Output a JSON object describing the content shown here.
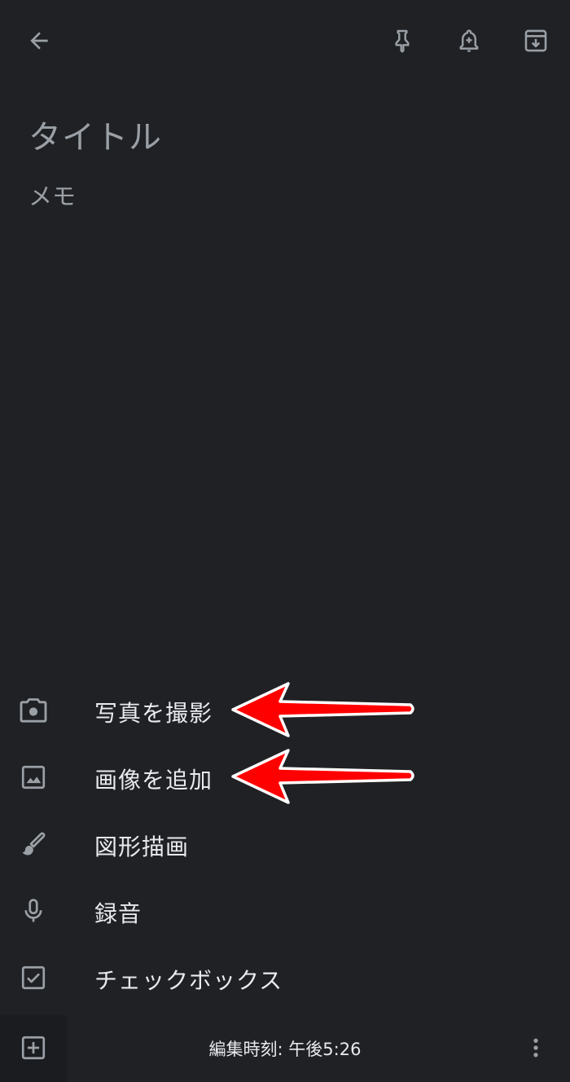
{
  "toolbar": {
    "back_icon": "arrow-left-icon",
    "pin_icon": "pin-icon",
    "reminder_icon": "bell-plus-icon",
    "archive_icon": "archive-icon"
  },
  "note": {
    "title_placeholder": "タイトル",
    "body_placeholder": "メモ"
  },
  "add_menu": {
    "items": [
      {
        "label": "写真を撮影",
        "icon": "camera-icon"
      },
      {
        "label": "画像を追加",
        "icon": "image-icon"
      },
      {
        "label": "図形描画",
        "icon": "brush-icon"
      },
      {
        "label": "録音",
        "icon": "microphone-icon"
      },
      {
        "label": "チェックボックス",
        "icon": "checkbox-icon"
      }
    ]
  },
  "bottom_bar": {
    "add_icon": "add-box-icon",
    "edited_time": "編集時刻: 午後5:26",
    "more_icon": "more-vert-icon"
  },
  "colors": {
    "background": "#202124",
    "text_primary": "#e8eaed",
    "text_hint": "#9aa0a6",
    "annotation_arrow": "#ff0000"
  }
}
